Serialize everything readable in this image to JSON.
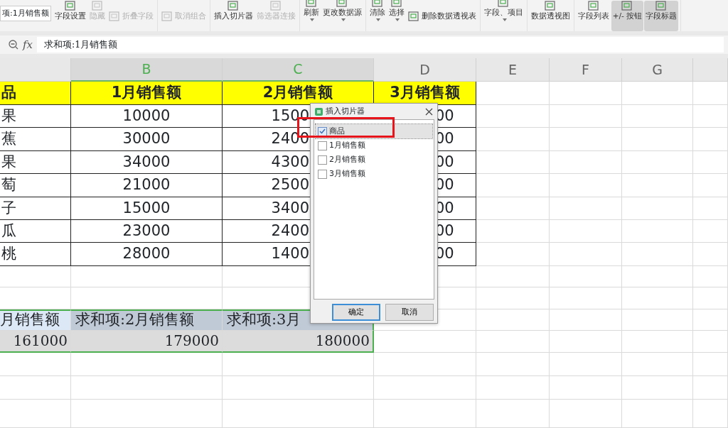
{
  "ribbon": {
    "name_box": "项:1月销售额",
    "groups": [
      {
        "items": [
          {
            "label": "字段设置",
            "kind": "large",
            "disabled": false,
            "selected": false,
            "dropdown": false
          },
          {
            "label": "隐藏",
            "kind": "large",
            "disabled": true,
            "selected": false,
            "dropdown": false
          },
          {
            "label": "折叠字段",
            "kind": "small",
            "disabled": true,
            "selected": false,
            "dropdown": false
          }
        ]
      },
      {
        "items": [
          {
            "label": "取消组合",
            "kind": "small",
            "disabled": true,
            "selected": false,
            "dropdown": false
          }
        ]
      },
      {
        "items": [
          {
            "label": "插入切片器",
            "kind": "large",
            "disabled": false,
            "selected": false,
            "dropdown": false
          },
          {
            "label": "筛选器连接",
            "kind": "large",
            "disabled": true,
            "selected": false,
            "dropdown": false
          }
        ]
      },
      {
        "items": [
          {
            "label": "刷新",
            "kind": "large",
            "disabled": false,
            "selected": false,
            "dropdown": true
          },
          {
            "label": "更改数据源",
            "kind": "large",
            "disabled": false,
            "selected": false,
            "dropdown": true
          }
        ]
      },
      {
        "items": [
          {
            "label": "清除",
            "kind": "large",
            "disabled": false,
            "selected": false,
            "dropdown": true
          },
          {
            "label": "选择",
            "kind": "large",
            "disabled": false,
            "selected": false,
            "dropdown": true
          },
          {
            "label": "删除数据透视表",
            "kind": "small",
            "disabled": false,
            "selected": false,
            "dropdown": false
          }
        ]
      },
      {
        "items": [
          {
            "label": "字段、项目",
            "kind": "large",
            "disabled": false,
            "selected": false,
            "dropdown": true
          }
        ]
      },
      {
        "items": [
          {
            "label": "数据透视图",
            "kind": "large",
            "disabled": false,
            "selected": false,
            "dropdown": false
          }
        ]
      },
      {
        "items": [
          {
            "label": "字段列表",
            "kind": "large",
            "disabled": false,
            "selected": false,
            "dropdown": false
          },
          {
            "label": "+/- 按钮",
            "kind": "large",
            "disabled": false,
            "selected": true,
            "dropdown": false
          },
          {
            "label": "字段标题",
            "kind": "large",
            "disabled": false,
            "selected": true,
            "dropdown": false
          }
        ]
      }
    ]
  },
  "formula_bar": {
    "function_label": "fx",
    "content": "求和项:1月销售额"
  },
  "columns": [
    {
      "label": "B",
      "selected": true
    },
    {
      "label": "C",
      "selected": true
    },
    {
      "label": "D",
      "selected": false
    },
    {
      "label": "E",
      "selected": false
    },
    {
      "label": "F",
      "selected": false
    },
    {
      "label": "G",
      "selected": false
    }
  ],
  "sheet": {
    "header_row": [
      "品",
      "1月销售额",
      "2月销售额",
      "3月销售额"
    ],
    "rows": [
      [
        "果",
        "10000",
        "1500",
        "00"
      ],
      [
        "蕉",
        "30000",
        "2400",
        "00"
      ],
      [
        "果",
        "34000",
        "4300",
        "00"
      ],
      [
        "萄",
        "21000",
        "2500",
        "00"
      ],
      [
        "子",
        "15000",
        "3400",
        "00"
      ],
      [
        "瓜",
        "23000",
        "2400",
        "00"
      ],
      [
        "桃",
        "28000",
        "1400",
        "00"
      ]
    ]
  },
  "pivot": {
    "header": [
      "月销售额",
      "求和项:2月销售额",
      "求和项:3月"
    ],
    "totals": [
      "161000",
      "179000",
      "180000"
    ]
  },
  "dialog": {
    "title": "插入切片器",
    "fields": [
      {
        "label": "商品",
        "checked": true,
        "selected": true
      },
      {
        "label": "1月销售额",
        "checked": false,
        "selected": false
      },
      {
        "label": "2月销售额",
        "checked": false,
        "selected": false
      },
      {
        "label": "3月销售额",
        "checked": false,
        "selected": false
      }
    ],
    "buttons": [
      {
        "label": "确定",
        "default": true
      },
      {
        "label": "取消",
        "default": false
      }
    ]
  }
}
